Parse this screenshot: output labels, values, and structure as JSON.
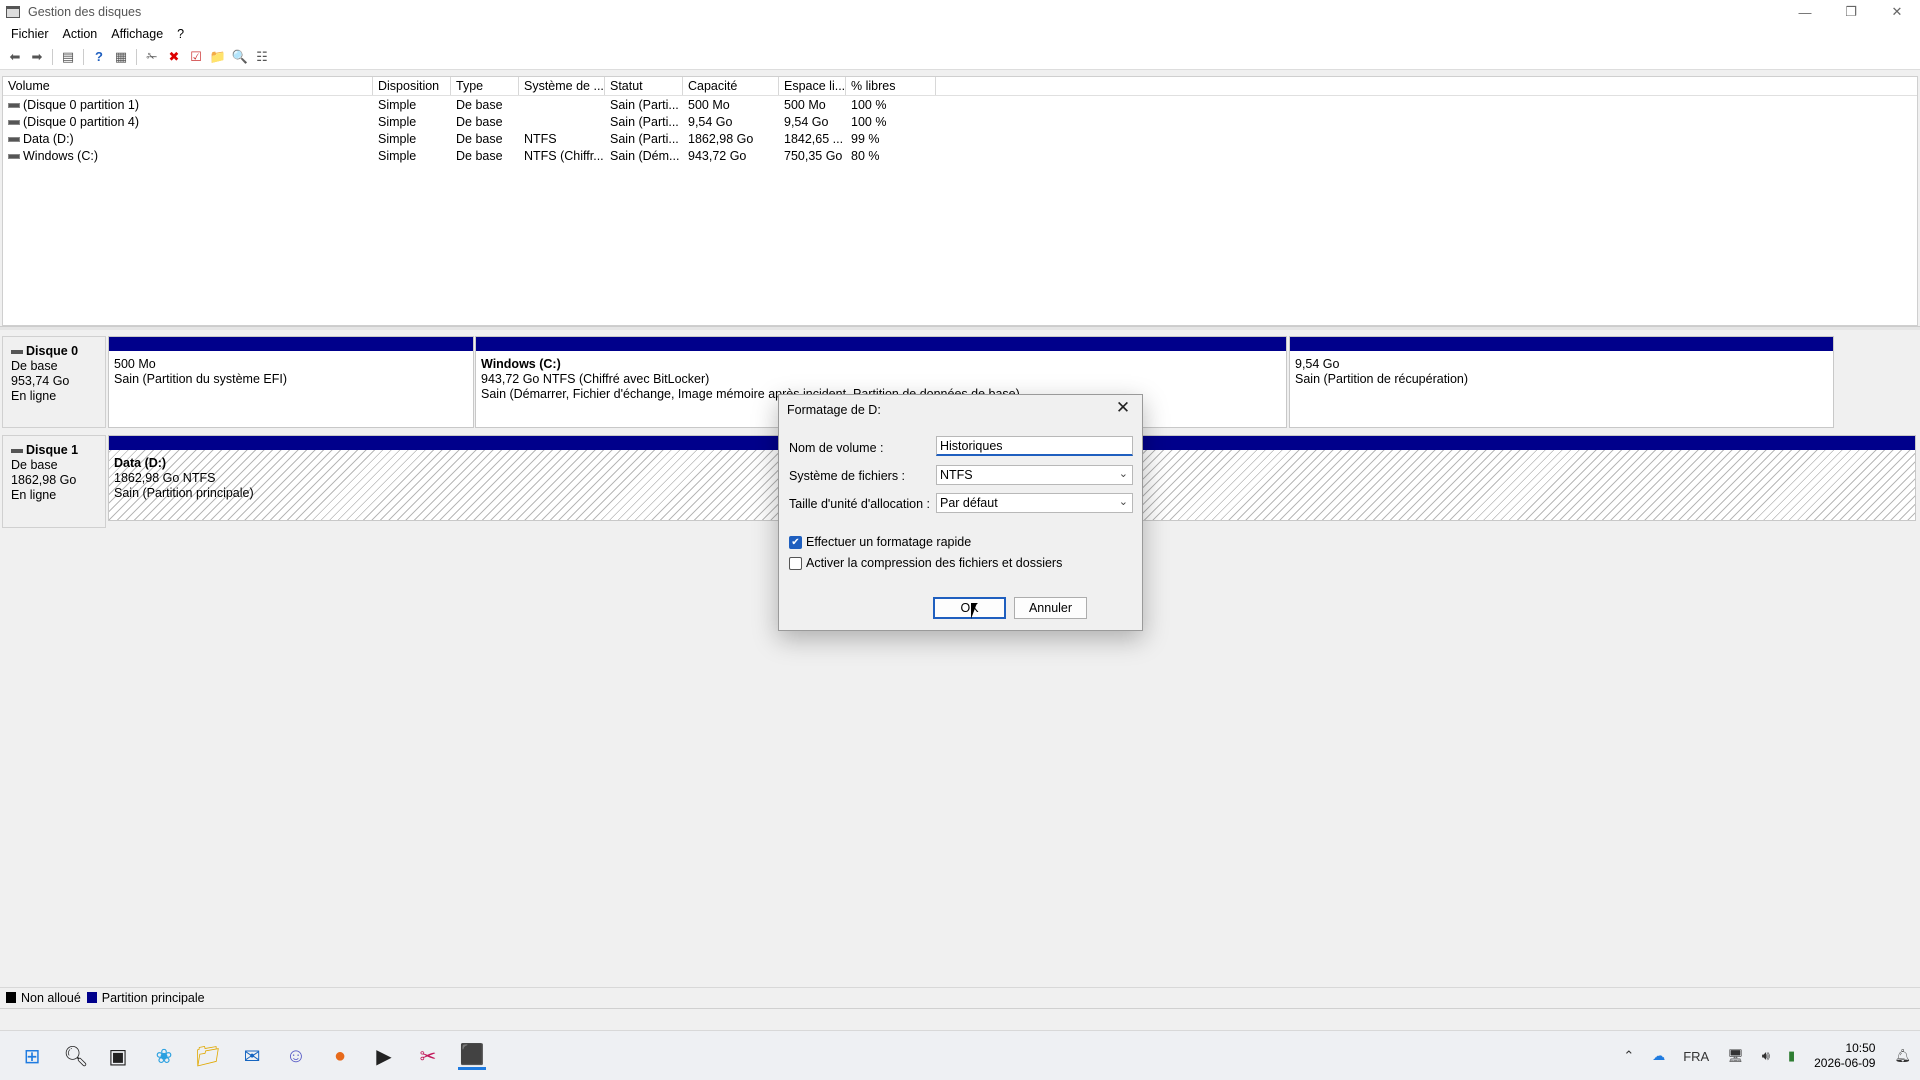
{
  "window": {
    "title": "Gestion des disques"
  },
  "menu": [
    "Fichier",
    "Action",
    "Affichage",
    "?"
  ],
  "volume_table": {
    "headers": [
      "Volume",
      "Disposition",
      "Type",
      "Système de ...",
      "Statut",
      "Capacité",
      "Espace li...",
      "% libres"
    ],
    "rows": [
      [
        "(Disque 0 partition 1)",
        "Simple",
        "De base",
        "",
        "Sain (Parti...",
        "500 Mo",
        "500 Mo",
        "100 %"
      ],
      [
        "(Disque 0 partition 4)",
        "Simple",
        "De base",
        "",
        "Sain (Parti...",
        "9,54 Go",
        "9,54 Go",
        "100 %"
      ],
      [
        "Data (D:)",
        "Simple",
        "De base",
        "NTFS",
        "Sain (Parti...",
        "1862,98 Go",
        "1842,65 ...",
        "99 %"
      ],
      [
        "Windows (C:)",
        "Simple",
        "De base",
        "NTFS (Chiffr...",
        "Sain (Dém...",
        "943,72 Go",
        "750,35 Go",
        "80 %"
      ]
    ]
  },
  "disks": [
    {
      "name": "Disque 0",
      "type": "De base",
      "size": "953,74 Go",
      "state": "En ligne",
      "partitions": [
        {
          "name": "",
          "line1": "500 Mo",
          "line2": "Sain (Partition du système EFI)",
          "line3": ""
        },
        {
          "name": "Windows  (C:)",
          "line1": "943,72 Go NTFS (Chiffré avec BitLocker)",
          "line2": "Sain (Démarrer, Fichier d'échange, Image mémoire après incident, Partition de données de base)",
          "line3": ""
        },
        {
          "name": "",
          "line1": "9,54 Go",
          "line2": "Sain (Partition de récupération)",
          "line3": ""
        }
      ]
    },
    {
      "name": "Disque 1",
      "type": "De base",
      "size": "1862,98 Go",
      "state": "En ligne",
      "partitions": [
        {
          "name": "Data  (D:)",
          "line1": "1862,98 Go NTFS",
          "line2": "Sain (Partition principale)",
          "line3": ""
        }
      ]
    }
  ],
  "legend": [
    {
      "label": "Non alloué",
      "color": "#000000"
    },
    {
      "label": "Partition principale",
      "color": "#00008b"
    }
  ],
  "dialog": {
    "title": "Formatage de D:",
    "volume_label": "Nom de volume :",
    "volume_value": "Historiques",
    "fs_label": "Système de fichiers :",
    "fs_value": "NTFS",
    "alloc_label": "Taille d'unité d'allocation :",
    "alloc_value": "Par défaut",
    "quick_format": {
      "label": "Effectuer un formatage rapide",
      "checked": true
    },
    "compression": {
      "label": "Activer la compression des fichiers et dossiers",
      "checked": false
    },
    "ok_label": "OK",
    "cancel_label": "Annuler"
  },
  "tray": {
    "lang": "FRA",
    "time": "10:50",
    "date": "2026-06-09"
  },
  "colors": {
    "partition_bar": "#00008b",
    "accent": "#1f5fbf"
  }
}
